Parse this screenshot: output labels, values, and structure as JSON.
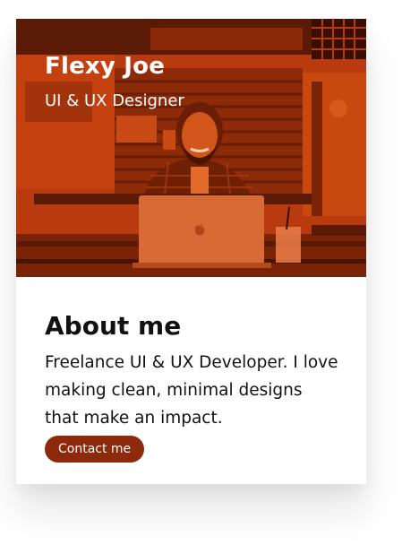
{
  "profile": {
    "name": "Flexy Joe",
    "role": "UI & UX Designer"
  },
  "about": {
    "title": "About me",
    "text": "Freelance UI & UX Developer. I love making clean, minimal designs that make an impact.",
    "button_label": "Contact me"
  },
  "colors": {
    "overlay": "#c2410c",
    "button": "#8c2a0b"
  },
  "icons": {
    "laptop_logo": "apple-icon"
  }
}
